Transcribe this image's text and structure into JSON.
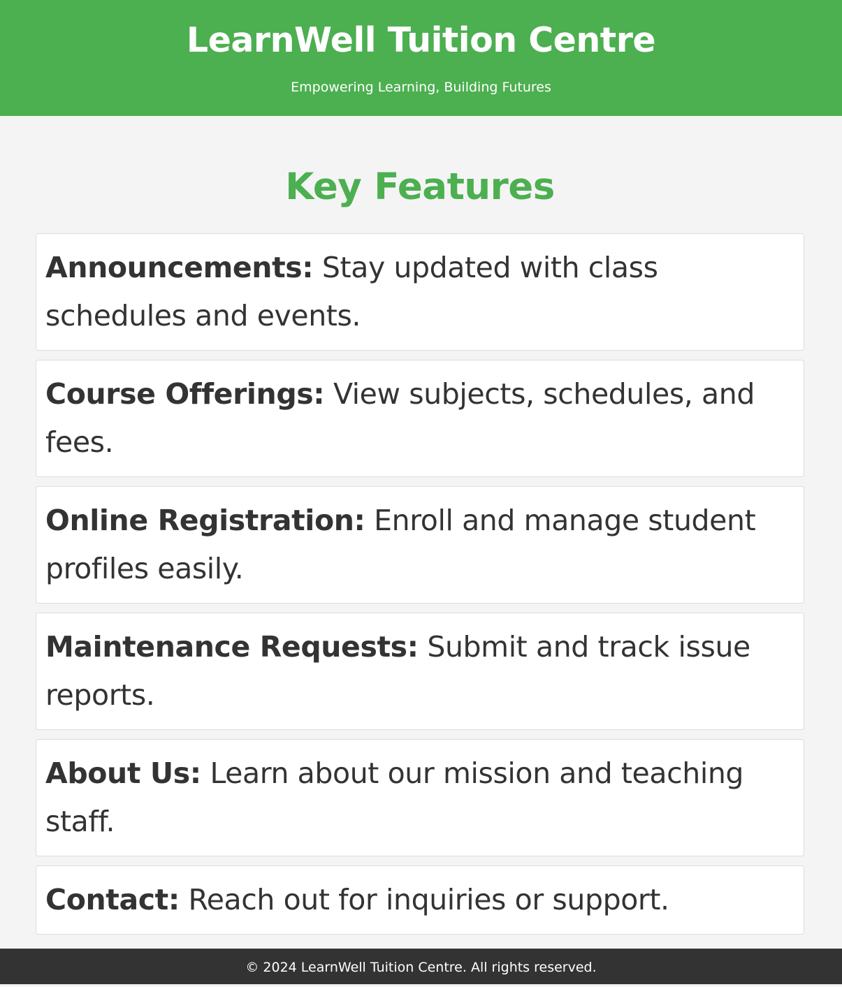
{
  "header": {
    "title": "LearnWell Tuition Centre",
    "tagline": "Empowering Learning, Building Futures"
  },
  "features": {
    "heading": "Key Features",
    "items": [
      {
        "name": "Announcements:",
        "description": "Stay updated with class schedules and events."
      },
      {
        "name": "Course Offerings:",
        "description": "View subjects, schedules, and fees."
      },
      {
        "name": "Online Registration:",
        "description": "Enroll and manage student profiles easily."
      },
      {
        "name": "Maintenance Requests:",
        "description": "Submit and track issue reports."
      },
      {
        "name": "About Us:",
        "description": "Learn about our mission and teaching staff."
      },
      {
        "name": "Contact:",
        "description": "Reach out for inquiries or support."
      }
    ]
  },
  "footer": {
    "copyright": "© 2024 LearnWell Tuition Centre. All rights reserved."
  },
  "colors": {
    "brand_green": "#4caf50",
    "page_background": "#f4f4f4",
    "card_background": "#ffffff",
    "footer_background": "#333333",
    "text": "#333333"
  }
}
